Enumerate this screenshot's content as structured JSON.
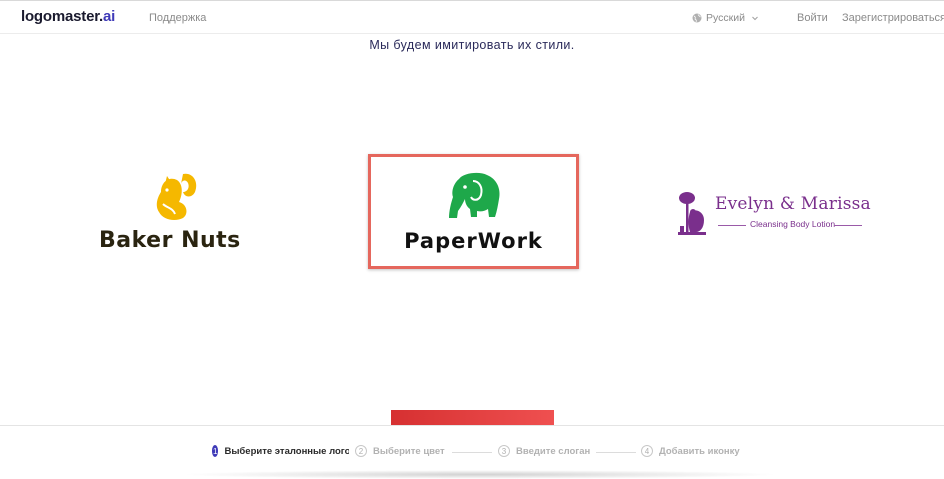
{
  "header": {
    "logo_main": "logomaster.",
    "logo_accent": "ai",
    "support_link": "Поддержка",
    "language": "Русский",
    "login": "Войти",
    "register": "Зарегистрироваться"
  },
  "intro": {
    "text": "Мы будем имитировать их стили."
  },
  "logos": [
    {
      "name": "Baker Nuts",
      "selected": false,
      "icon": "squirrel-icon",
      "color": "#f5b800"
    },
    {
      "name": "PaperWork",
      "selected": true,
      "icon": "elephant-icon",
      "color": "#1ea84a"
    },
    {
      "name": "Evelyn & Marissa",
      "tagline": "Cleansing Body Lotion",
      "selected": false,
      "icon": "bear-tree-icon",
      "color": "#7a2f8c"
    }
  ],
  "stepper": {
    "steps": [
      {
        "num": "1",
        "label": "Выберите эталонные логотипы",
        "active": true
      },
      {
        "num": "2",
        "label": "Выберите цвет",
        "active": false
      },
      {
        "num": "3",
        "label": "Введите слоган",
        "active": false
      },
      {
        "num": "4",
        "label": "Добавить иконку",
        "active": false
      }
    ]
  },
  "colors": {
    "accent": "#3f3ab8",
    "selection_border": "#e5675d",
    "next_button": "#e03a3a"
  }
}
